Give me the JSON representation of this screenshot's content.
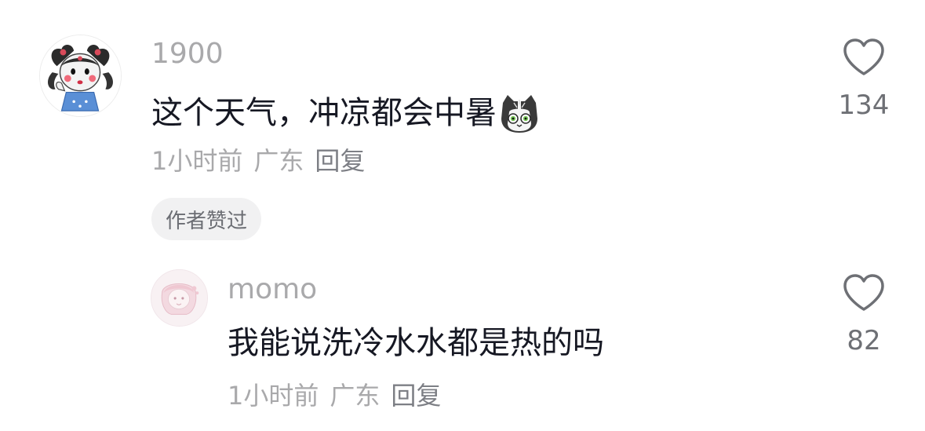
{
  "comments": [
    {
      "username": "1900",
      "text": "这个天气，冲凉都会中暑",
      "emoji": "cat-face-emoji",
      "time": "1小时前",
      "location": "广东",
      "reply_label": "回复",
      "badge": "作者赞过",
      "like_count": "134"
    },
    {
      "username": "momo",
      "text": "我能说洗冷水水都是热的吗",
      "time": "1小时前",
      "location": "广东",
      "reply_label": "回复",
      "like_count": "82"
    }
  ],
  "colors": {
    "text_primary": "#161823",
    "text_secondary": "#a9a9ab",
    "badge_bg": "#f1f1f2",
    "icon": "#6e7075"
  }
}
